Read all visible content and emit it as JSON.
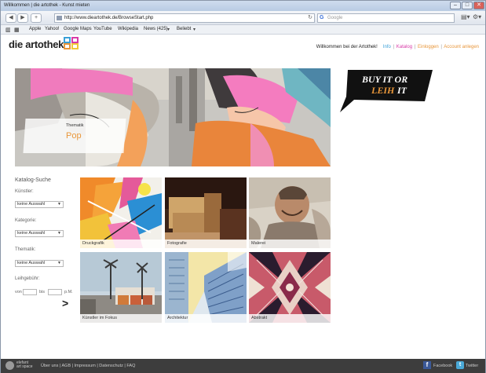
{
  "window": {
    "title": "Willkommen | die artothek - Kunst mieten"
  },
  "browser": {
    "url": "http://www.dieartothek.de/BrowseStart.php",
    "search_placeholder": "Google",
    "bookmarks": [
      "Apple",
      "Yahoo!",
      "Google Maps",
      "YouTube",
      "Wikipedia",
      "News (425)",
      "Beliebt"
    ]
  },
  "site": {
    "logo_text": "die artothek",
    "welcome": "Willkommen bei der Artothek!",
    "nav": {
      "info": "Info",
      "katalog": "Katalog",
      "einloggen": "Einloggen",
      "account": "Account anlegen"
    },
    "colors": {
      "accent_orange": "#e8963a",
      "accent_pink": "#d83aa8",
      "accent_blue": "#39a0d8"
    }
  },
  "hero": {
    "thematik_label": "Thematik",
    "thematik_value": "Pop"
  },
  "promo": {
    "line1": "BUY IT OR",
    "line2_accent": "LEIH",
    "line2_rest": "IT"
  },
  "search": {
    "title": "Katalog-Suche",
    "kuenstler_label": "Künstler:",
    "kuenstler_value": "keine Auswahl",
    "kategorie_label": "Kategorie:",
    "kategorie_value": "keine Auswahl",
    "thematik_label": "Thematik:",
    "thematik_value": "keine Auswahl",
    "leihgebuehr_label": "Leihgebühr:",
    "von": "von",
    "bis": "bis",
    "pm": "p.M.",
    "go": ">"
  },
  "tiles": [
    {
      "label": "Druckgrafik"
    },
    {
      "label": "Fotografie"
    },
    {
      "label": "Malerei"
    },
    {
      "label": "Künstler im Fokus"
    },
    {
      "label": "Architektur"
    },
    {
      "label": "Abstrakt"
    }
  ],
  "footer": {
    "elefant_line1": "elefant",
    "elefant_line2": "art space",
    "links": "Über uns | AGB | Impressum | Datenschutz | FAQ",
    "facebook": "Facebook",
    "twitter": "Twitter"
  }
}
